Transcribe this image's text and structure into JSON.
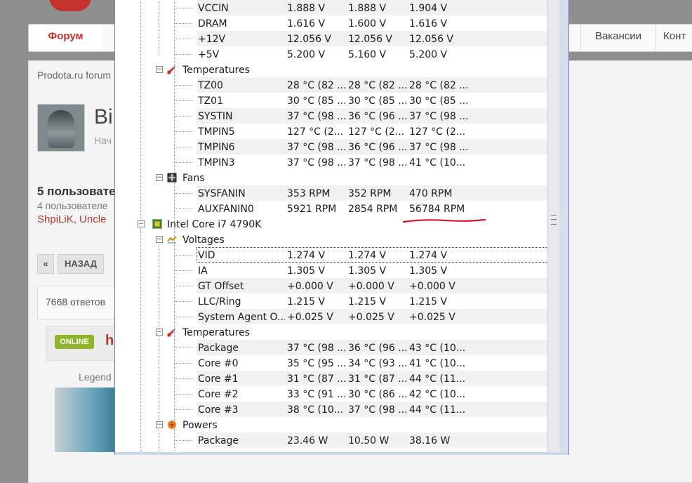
{
  "forum": {
    "nav": [
      "Форум",
      "Вакансии",
      "Конт"
    ],
    "breadcrumb": "Prodota.ru forum",
    "title_partial": "Bi",
    "subtitle_partial": "Нач",
    "users_heading": "5 пользовате",
    "users_sub": "4 пользователе",
    "users_names": "ShpiLiK, Uncle",
    "pager_prev": "«",
    "pager_back": "НАЗАД",
    "replies": "7668 ответов",
    "online_badge": "ONLINE",
    "author_partial": "h",
    "legend": "Legend"
  },
  "hwmonitor": {
    "rows": [
      {
        "kind": "value",
        "name": "VCCIN",
        "v1": "1.888 V",
        "v2": "1.888 V",
        "v3": "1.904 V"
      },
      {
        "kind": "value",
        "name": "DRAM",
        "v1": "1.616 V",
        "v2": "1.600 V",
        "v3": "1.616 V"
      },
      {
        "kind": "value",
        "name": "+12V",
        "v1": "12.056 V",
        "v2": "12.056 V",
        "v3": "12.056 V"
      },
      {
        "kind": "value",
        "name": "+5V",
        "v1": "5.200 V",
        "v2": "5.160 V",
        "v3": "5.200 V"
      },
      {
        "kind": "group",
        "name": "Temperatures",
        "icon": "thermometer-icon"
      },
      {
        "kind": "value",
        "name": "TZ00",
        "v1": "28 °C  (82 ...",
        "v2": "28 °C  (82 ...",
        "v3": "28 °C  (82 ..."
      },
      {
        "kind": "value",
        "name": "TZ01",
        "v1": "30 °C  (85 ...",
        "v2": "30 °C  (85 ...",
        "v3": "30 °C  (85 ..."
      },
      {
        "kind": "value",
        "name": "SYSTIN",
        "v1": "37 °C  (98 ...",
        "v2": "36 °C  (96 ...",
        "v3": "37 °C  (98 ..."
      },
      {
        "kind": "value",
        "name": "TMPIN5",
        "v1": "127 °C  (2...",
        "v2": "127 °C  (2...",
        "v3": "127 °C  (2..."
      },
      {
        "kind": "value",
        "name": "TMPIN6",
        "v1": "37 °C  (98 ...",
        "v2": "36 °C  (96 ...",
        "v3": "37 °C  (98 ..."
      },
      {
        "kind": "value",
        "name": "TMPIN3",
        "v1": "37 °C  (98 ...",
        "v2": "37 °C  (98 ...",
        "v3": "41 °C  (10..."
      },
      {
        "kind": "group",
        "name": "Fans",
        "icon": "fan-icon"
      },
      {
        "kind": "value",
        "name": "SYSFANIN",
        "v1": "353 RPM",
        "v2": "352 RPM",
        "v3": "470 RPM"
      },
      {
        "kind": "value",
        "name": "AUXFANIN0",
        "v1": "5921 RPM",
        "v2": "2854 RPM",
        "v3": "56784 RPM"
      },
      {
        "kind": "device",
        "name": "Intel Core i7 4790K",
        "icon": "cpu-chip-icon"
      },
      {
        "kind": "group",
        "name": "Voltages",
        "icon": "voltage-icon"
      },
      {
        "kind": "value",
        "name": "VID",
        "v1": "1.274 V",
        "v2": "1.274 V",
        "v3": "1.274 V",
        "selected": true
      },
      {
        "kind": "value",
        "name": "IA",
        "v1": "1.305 V",
        "v2": "1.305 V",
        "v3": "1.305 V"
      },
      {
        "kind": "value",
        "name": "GT Offset",
        "v1": "+0.000 V",
        "v2": "+0.000 V",
        "v3": "+0.000 V"
      },
      {
        "kind": "value",
        "name": "LLC/Ring",
        "v1": "1.215 V",
        "v2": "1.215 V",
        "v3": "1.215 V"
      },
      {
        "kind": "value",
        "name": "System Agent O...",
        "v1": "+0.025 V",
        "v2": "+0.025 V",
        "v3": "+0.025 V"
      },
      {
        "kind": "group",
        "name": "Temperatures",
        "icon": "thermometer-icon"
      },
      {
        "kind": "value",
        "name": "Package",
        "v1": "37 °C  (98 ...",
        "v2": "36 °C  (96 ...",
        "v3": "43 °C  (10..."
      },
      {
        "kind": "value",
        "name": "Core #0",
        "v1": "35 °C  (95 ...",
        "v2": "34 °C  (93 ...",
        "v3": "41 °C  (10..."
      },
      {
        "kind": "value",
        "name": "Core #1",
        "v1": "31 °C  (87 ...",
        "v2": "31 °C  (87 ...",
        "v3": "44 °C  (11..."
      },
      {
        "kind": "value",
        "name": "Core #2",
        "v1": "33 °C  (91 ...",
        "v2": "30 °C  (86 ...",
        "v3": "42 °C  (10..."
      },
      {
        "kind": "value",
        "name": "Core #3",
        "v1": "38 °C  (10...",
        "v2": "37 °C  (98 ...",
        "v3": "44 °C  (11..."
      },
      {
        "kind": "group",
        "name": "Powers",
        "icon": "power-icon"
      },
      {
        "kind": "value",
        "name": "Package",
        "v1": "23.46 W",
        "v2": "10.50 W",
        "v3": "38.16 W"
      }
    ],
    "annotation_color": "#d6142c"
  }
}
